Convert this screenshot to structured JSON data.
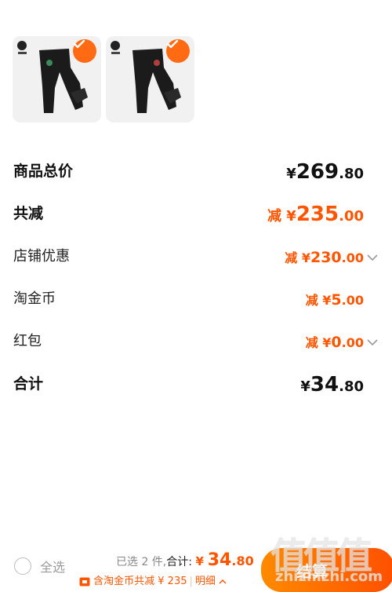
{
  "products": [
    {
      "name": "black-jogger-pants-1",
      "selected": true
    },
    {
      "name": "black-jogger-pants-2",
      "selected": true
    }
  ],
  "price_rows": [
    {
      "label": "商品总价",
      "prefix": "¥",
      "int": "269",
      "dec": ".80",
      "style": "total"
    },
    {
      "label": "共减",
      "prefix": "减 ¥",
      "int": "235",
      "dec": ".00",
      "style": "discount-total"
    },
    {
      "label": "店铺优惠",
      "prefix": "减 ¥",
      "int": "230",
      "dec": ".00",
      "style": "discount",
      "expandable": true
    },
    {
      "label": "淘金币",
      "prefix": "减 ¥",
      "int": "5",
      "dec": ".00",
      "style": "discount"
    },
    {
      "label": "红包",
      "prefix": "减 ¥",
      "int": "0",
      "dec": ".00",
      "style": "discount",
      "expandable": true
    },
    {
      "label": "合计",
      "prefix": "¥",
      "int": "34",
      "dec": ".80",
      "style": "total"
    }
  ],
  "bottom_bar": {
    "select_all": "全选",
    "selected_count": "已选 2 件,",
    "total_label": "合计:",
    "total_prefix": "¥",
    "total_int": "34",
    "total_dec": ".80",
    "discount_note": "含淘金币共减 ¥ 235",
    "detail_label": "明细",
    "checkout_label": "结算"
  },
  "watermark": {
    "text_big": "值值值",
    "text_small": "zhizhizhi.com"
  },
  "colors": {
    "accent": "#ff5500",
    "check": "#ff6a12",
    "checkout_start": "#ff8a00",
    "checkout_end": "#ff5000"
  },
  "icons": [
    "checkmark-icon",
    "chevron-down-icon",
    "chevron-up-icon",
    "coupon-icon",
    "radio-unchecked-icon"
  ]
}
